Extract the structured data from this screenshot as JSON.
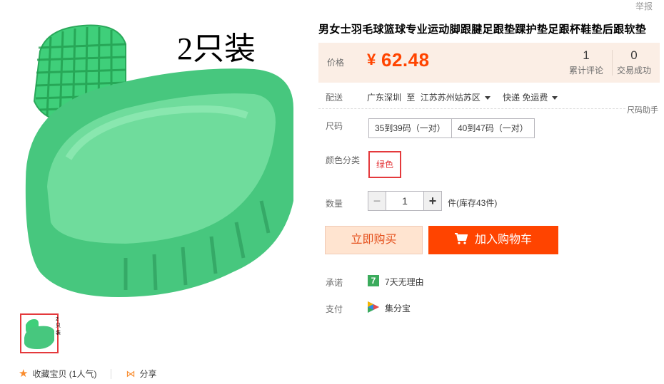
{
  "header": {
    "report_label": "举报"
  },
  "gallery": {
    "main_image_caption": "2只装",
    "thumb_caption": "2只装"
  },
  "actions": {
    "favorite_label": "收藏宝贝 (1人气)",
    "share_label": "分享",
    "favorite_icon": "star-icon",
    "share_icon": "share-icon"
  },
  "product": {
    "title": "男女士羽毛球篮球专业运动脚跟腱足跟垫踝护垫足跟杯鞋垫后跟软垫",
    "price_label": "价格",
    "currency": "¥",
    "price": "62.48",
    "stats": [
      {
        "value": "1",
        "label": "累计评论"
      },
      {
        "value": "0",
        "label": "交易成功"
      }
    ],
    "accent_color": "#ff4400"
  },
  "shipping": {
    "label": "配送",
    "from": "广东深圳",
    "to_word": "至",
    "to": "江苏苏州姑苏区",
    "method": "快递 免运费"
  },
  "size_help_label": "尺码助手",
  "size": {
    "label": "尺码",
    "options": [
      "35到39码（一对）",
      "40到47码（一对）"
    ]
  },
  "color": {
    "label": "颜色分类",
    "options": [
      "绿色"
    ],
    "selected": "绿色"
  },
  "quantity": {
    "label": "数量",
    "minus": "−",
    "value": "1",
    "plus": "+",
    "stock_text": "件(库存43件)"
  },
  "buttons": {
    "buy_now": "立即购买",
    "add_to_cart": "加入购物车"
  },
  "promise": {
    "label": "承诺",
    "icon_text": "7",
    "text": "7天无理由"
  },
  "payment": {
    "label": "支付",
    "text": "集分宝"
  }
}
